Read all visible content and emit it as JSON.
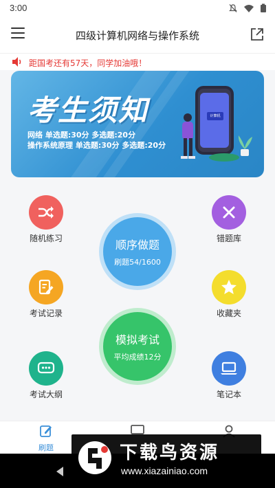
{
  "status_bar": {
    "time": "3:00"
  },
  "app_bar": {
    "title": "四级计算机网络与操作系统"
  },
  "notice": {
    "text": "距国考还有57天，同学加油哦！"
  },
  "banner": {
    "headline": "考生须知",
    "line1": "网络 单选题:30分  多选题:20分",
    "line2": "操作系统原理  单选题:30分  多选题:20分",
    "phone_chip_text": "计算机"
  },
  "features": {
    "random": {
      "label": "随机练习",
      "icon": "shuffle-icon",
      "color": "#f0615e"
    },
    "wrong": {
      "label": "错题库",
      "icon": "close-icon",
      "color": "#a35fe0"
    },
    "records": {
      "label": "考试记录",
      "icon": "edit-doc-icon",
      "color": "#f5a623"
    },
    "favorites": {
      "label": "收藏夹",
      "icon": "star-icon",
      "color": "#f4dd2d"
    },
    "outline": {
      "label": "考试大纲",
      "icon": "chat-dots-icon",
      "color": "#1fb38c"
    },
    "notes": {
      "label": "笔记本",
      "icon": "laptop-icon",
      "color": "#3f7fe0"
    }
  },
  "sequential": {
    "title": "顺序做题",
    "progress_text": "刷题54/1600",
    "done": 54,
    "total": 1600,
    "color": "#4aa8e8"
  },
  "mock": {
    "title": "模拟考试",
    "score_text": "平均成绩12分",
    "color": "#36c46a"
  },
  "tabbar": {
    "practice_label": "刷题",
    "accent": "#3a8fd8"
  },
  "watermark": {
    "title": "下载鸟资源",
    "url": "www.xiazainiao.com"
  }
}
